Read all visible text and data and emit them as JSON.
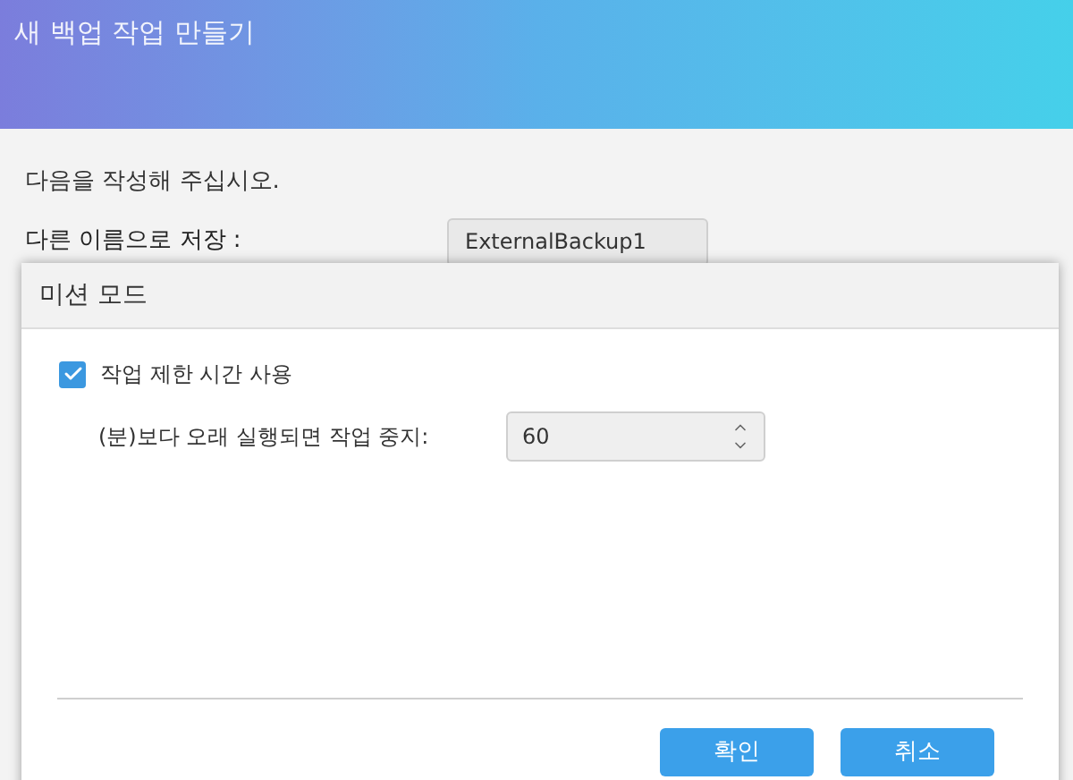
{
  "window": {
    "title": "새 백업 작업 만들기"
  },
  "form": {
    "instruction": "다음을 작성해 주십시오.",
    "save_as_label": "다른 이름으로 저장 :",
    "save_as_value": "ExternalBackup1"
  },
  "dialog": {
    "title": "미션 모드",
    "timeout_checkbox": {
      "label": "작업 제한 시간 사용",
      "checked": true
    },
    "timeout_field": {
      "label": "(분)보다 오래 실행되면 작업 중지:",
      "value": "60"
    },
    "buttons": [
      {
        "label": "확인"
      },
      {
        "label": "취소"
      }
    ]
  }
}
